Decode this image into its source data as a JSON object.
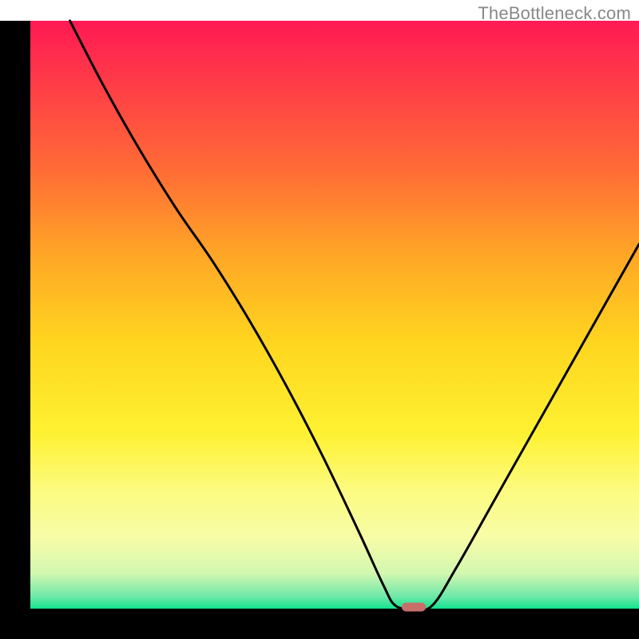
{
  "watermark": "TheBottleneck.com",
  "chart_data": {
    "type": "line",
    "title": "",
    "xlabel": "",
    "ylabel": "",
    "xlim": [
      0,
      100
    ],
    "ylim": [
      0,
      100
    ],
    "axis_color": "#000000",
    "line_color": "#000000",
    "marker": {
      "x": 63,
      "y": 0,
      "color": "#c86f6a",
      "width": 4,
      "height": 1.5
    },
    "gradient_stops": [
      {
        "offset": 0.0,
        "color": "#ff1a54"
      },
      {
        "offset": 0.1,
        "color": "#ff3a48"
      },
      {
        "offset": 0.25,
        "color": "#ff6a36"
      },
      {
        "offset": 0.4,
        "color": "#ffa726"
      },
      {
        "offset": 0.55,
        "color": "#ffd61f"
      },
      {
        "offset": 0.7,
        "color": "#fef131"
      },
      {
        "offset": 0.8,
        "color": "#fcfb80"
      },
      {
        "offset": 0.88,
        "color": "#f7fca8"
      },
      {
        "offset": 0.94,
        "color": "#d2f7b0"
      },
      {
        "offset": 0.98,
        "color": "#6ce8a8"
      },
      {
        "offset": 1.0,
        "color": "#12e38f"
      }
    ],
    "series": [
      {
        "name": "bottleneck-curve",
        "points": [
          {
            "x": 6.5,
            "y": 100
          },
          {
            "x": 12,
            "y": 89
          },
          {
            "x": 18,
            "y": 78
          },
          {
            "x": 24,
            "y": 68
          },
          {
            "x": 30,
            "y": 59
          },
          {
            "x": 36,
            "y": 49
          },
          {
            "x": 42,
            "y": 38
          },
          {
            "x": 48,
            "y": 26
          },
          {
            "x": 54,
            "y": 13
          },
          {
            "x": 58,
            "y": 4
          },
          {
            "x": 60,
            "y": 0.5
          },
          {
            "x": 63,
            "y": 0
          },
          {
            "x": 66,
            "y": 0.5
          },
          {
            "x": 70,
            "y": 7
          },
          {
            "x": 76,
            "y": 18
          },
          {
            "x": 82,
            "y": 29
          },
          {
            "x": 88,
            "y": 40
          },
          {
            "x": 94,
            "y": 51
          },
          {
            "x": 100,
            "y": 62
          }
        ]
      }
    ]
  }
}
